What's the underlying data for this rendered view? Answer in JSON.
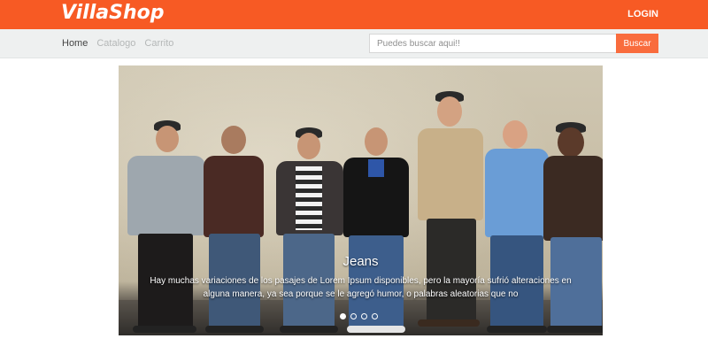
{
  "header": {
    "logo": "VillaShop",
    "login_label": "LOGIN"
  },
  "nav": {
    "items": [
      {
        "label": "Home",
        "active": true
      },
      {
        "label": "Catalogo",
        "active": false
      },
      {
        "label": "Carrito",
        "active": false
      }
    ]
  },
  "search": {
    "placeholder": "Puedes buscar aqui!!",
    "value": "",
    "button_label": "Buscar"
  },
  "carousel": {
    "slide_title": "Jeans",
    "slide_text": "Hay muchas variaciones de los pasajes de Lorem Ipsum disponibles, pero la mayoría sufrió alteraciones en alguna manera, ya sea porque se le agregó humor, o palabras aleatorias que no",
    "indicator_count": 4,
    "active_indicator": 0
  },
  "colors": {
    "brand": "#f75a24",
    "button": "#f96c3d",
    "navbar": "#eef0f0"
  }
}
